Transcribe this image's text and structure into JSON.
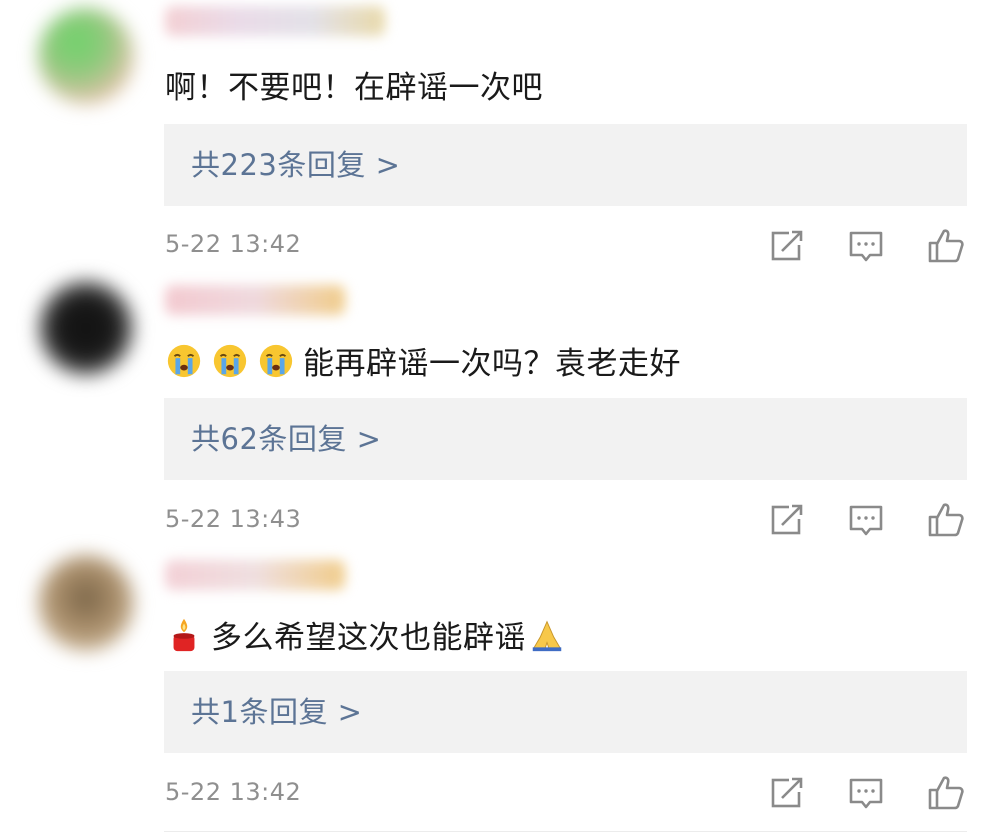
{
  "comments": [
    {
      "text": "啊！不要吧！在辟谣一次吧",
      "replies": "共223条回复 >",
      "time": "5-22 13:42",
      "avatar_color": "#86c47a"
    },
    {
      "text": "能再辟谣一次吗？袁老走好",
      "replies": "共62条回复 >",
      "time": "5-22 13:43",
      "avatar_color": "#2a2a2a",
      "emojis": [
        "crying-emoji",
        "crying-emoji",
        "crying-emoji"
      ]
    },
    {
      "text": "多么希望这次也能辟谣",
      "replies": "共1条回复 >",
      "time": "5-22 13:42",
      "avatar_color": "#b89c7c",
      "emojis_before": [
        "candle-emoji"
      ],
      "emojis_after": [
        "praying-hands-emoji"
      ]
    }
  ],
  "colors": {
    "reply_link": "#5c7495",
    "timestamp": "#8f8f8f",
    "reply_bg": "#f2f2f2",
    "icon": "#8a8a8a"
  },
  "icons": [
    "share-icon",
    "comment-icon",
    "like-icon"
  ]
}
